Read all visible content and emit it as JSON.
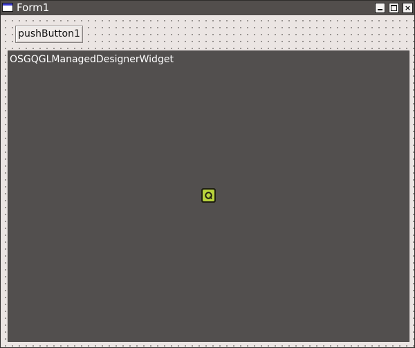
{
  "window": {
    "title": "Form1",
    "icons": {
      "app": "window-icon",
      "minimize": "minimize-icon",
      "maximize": "maximize-icon",
      "close": "close-icon"
    },
    "close_glyph": "×"
  },
  "form": {
    "push_button_label": "pushButton1",
    "widget": {
      "label": "OSGQGLManagedDesignerWidget",
      "icon": "qt-logo-icon"
    }
  },
  "colors": {
    "titlebar": "#524e4c",
    "form_background": "#ebe5e3",
    "widget_background": "#524f4e",
    "logo_green": "#b8d23c"
  }
}
